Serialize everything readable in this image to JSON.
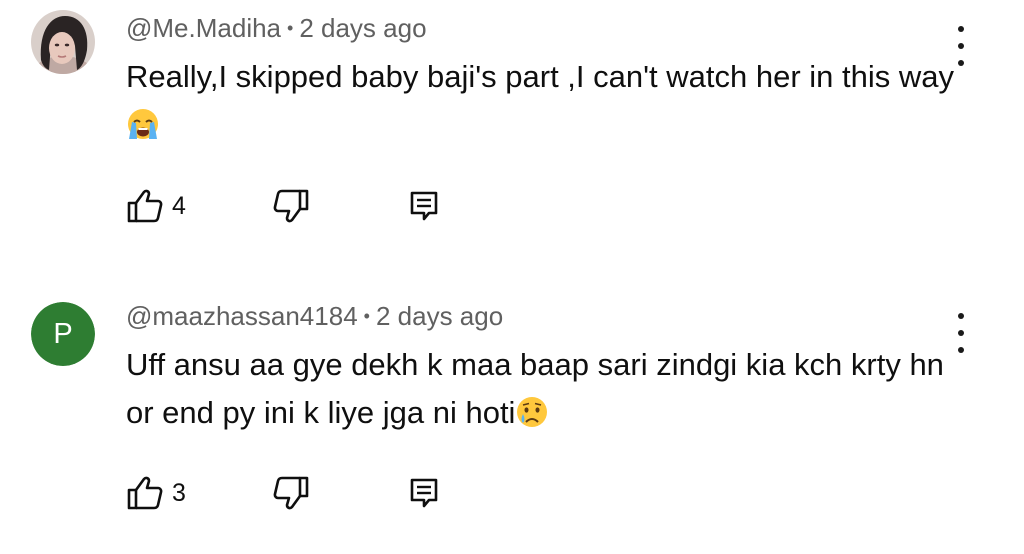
{
  "comments": [
    {
      "author": "@Me.Madiha",
      "separator": "•",
      "time": "2 days ago",
      "text": "Really,I skipped baby baji's  part ,I can't watch her in this way",
      "emoji_icon": "loudly-crying-face-icon",
      "likes": "4"
    },
    {
      "author": "@maazhassan4184",
      "separator": "•",
      "time": "2 days ago",
      "text": "Uff ansu aa gye dekh k maa baap sari zindgi kia kch krty hn or end py ini k liye jga ni hoti",
      "emoji_icon": "crying-face-icon",
      "likes": "3",
      "avatar_letter": "P",
      "avatar_color": "#2e7d32"
    }
  ]
}
